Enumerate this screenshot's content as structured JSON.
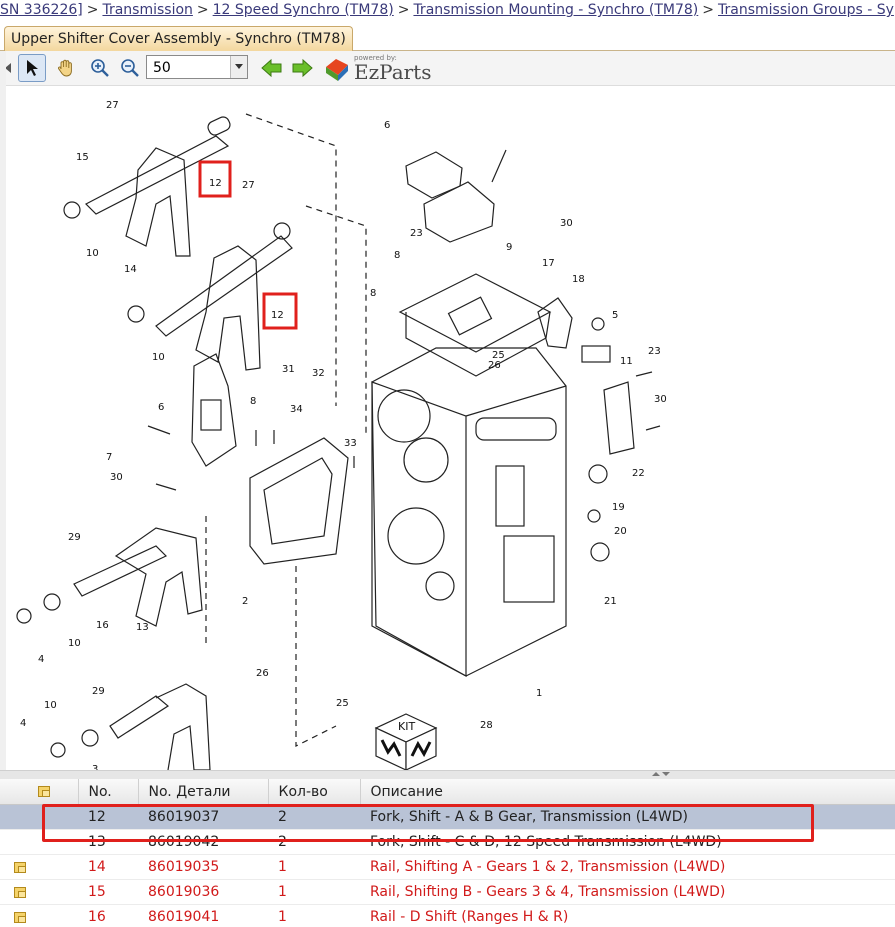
{
  "breadcrumb": {
    "items": [
      {
        "text": "SN 336226]",
        "link": true
      },
      {
        "text": "Transmission",
        "link": true
      },
      {
        "text": "12 Speed Synchro (TM78)",
        "link": true
      },
      {
        "text": "Transmission Mounting - Synchro (TM78)",
        "link": true
      },
      {
        "text": "Transmission Groups - Sy",
        "link": true
      }
    ],
    "separator": ">"
  },
  "tab": {
    "label": "Upper Shifter Cover Assembly - Synchro (TM78)"
  },
  "toolbar": {
    "zoom_value": "50",
    "logo_powered": "powered by:",
    "logo_name": "EzParts"
  },
  "diagram": {
    "callouts": [
      "27",
      "15",
      "12",
      "27",
      "10",
      "14",
      "12",
      "10",
      "6",
      "7",
      "30",
      "31",
      "32",
      "8",
      "34",
      "33",
      "29",
      "2",
      "4",
      "16",
      "13",
      "10",
      "26",
      "29",
      "10",
      "4",
      "3",
      "25",
      "6",
      "23",
      "30",
      "8",
      "9",
      "17",
      "18",
      "8",
      "5",
      "25",
      "26",
      "11",
      "23",
      "30",
      "22",
      "19",
      "20",
      "21",
      "1",
      "28"
    ],
    "kit_label": "KIT"
  },
  "grid": {
    "headers": {
      "icon": "",
      "no": "No.",
      "part_no": "No. Детали",
      "qty": "Кол-во",
      "desc": "Описание"
    },
    "rows": [
      {
        "icon": false,
        "no": "12",
        "part_no": "86019037",
        "qty": "2",
        "desc": "Fork, Shift - A & B Gear, Transmission (L4WD)",
        "state": "selected"
      },
      {
        "icon": false,
        "no": "13",
        "part_no": "86019042",
        "qty": "2",
        "desc": "Fork, Shift - C & D, 12 Speed Transmission (L4WD)",
        "state": "plain"
      },
      {
        "icon": true,
        "no": "14",
        "part_no": "86019035",
        "qty": "1",
        "desc": "Rail, Shifting A - Gears 1 & 2, Transmission (L4WD)",
        "state": "red"
      },
      {
        "icon": true,
        "no": "15",
        "part_no": "86019036",
        "qty": "1",
        "desc": "Rail, Shifting B - Gears 3 & 4, Transmission (L4WD)",
        "state": "red"
      },
      {
        "icon": true,
        "no": "16",
        "part_no": "86019041",
        "qty": "1",
        "desc": "Rail - D Shift (Ranges H & R)",
        "state": "red"
      }
    ]
  },
  "colors": {
    "highlight_red": "#e0201c",
    "selected_row": "#b9c3d6",
    "red_text": "#d11a1a",
    "tab_bg": "#f3d79e"
  }
}
